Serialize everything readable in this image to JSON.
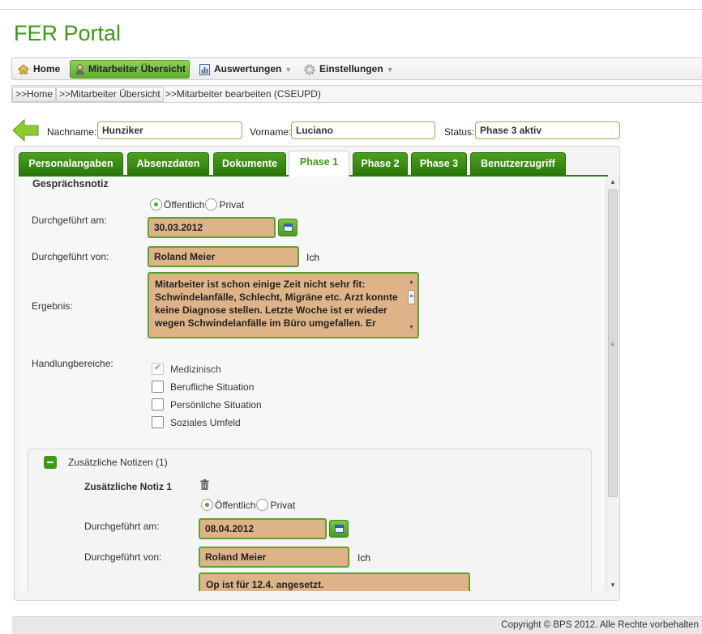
{
  "app": {
    "title": "FER Portal"
  },
  "nav": {
    "home": "Home",
    "mitarbeiter": "Mitarbeiter Übersicht",
    "auswertungen": "Auswertungen",
    "einstellungen": "Einstellungen"
  },
  "breadcrumb": {
    "home": ">>Home",
    "mitarbeiter": ">>Mitarbeiter Übersicht",
    "current": ">>Mitarbeiter bearbeiten (CSEUPD)"
  },
  "header": {
    "nachname_label": "Nachname:",
    "nachname_value": "Hunziker",
    "vorname_label": "Vorname:",
    "vorname_value": "Luciano",
    "status_label": "Status:",
    "status_value": "Phase 3 aktiv"
  },
  "tabs": [
    {
      "label": "Personalangaben"
    },
    {
      "label": "Absenzdaten"
    },
    {
      "label": "Dokumente"
    },
    {
      "label": "Phase 1",
      "active": true
    },
    {
      "label": "Phase 2"
    },
    {
      "label": "Phase 3"
    },
    {
      "label": "Benutzerzugriff"
    }
  ],
  "form": {
    "section_title": "Gesprächsnotiz",
    "visibility": {
      "public": "Öffentlich",
      "private": "Privat",
      "selected": "Öffentlich"
    },
    "date_label": "Durchgeführt am:",
    "date_value": "30.03.2012",
    "by_label": "Durchgeführt von:",
    "by_value": "Roland Meier",
    "by_me": "Ich",
    "result_label": "Ergebnis:",
    "result_value": "Mitarbeiter ist schon einige Zeit nicht sehr fit: Schwindelanfälle, Schlecht, Migräne etc. Arzt konnte keine Diagnose stellen. Letzte Woche ist er wieder wegen Schwindelanfälle im Büro umgefallen.  Er",
    "areas_label": "Handlungbereiche:",
    "areas": [
      {
        "label": "Medizinisch",
        "checked": true
      },
      {
        "label": "Berufliche Situation",
        "checked": false
      },
      {
        "label": "Persönliche Situation",
        "checked": false
      },
      {
        "label": "Soziales Umfeld",
        "checked": false
      }
    ]
  },
  "notes": {
    "header": "Zusätzliche Notizen (1)",
    "note_title": "Zusätzliche Notiz 1",
    "visibility": {
      "public": "Öffentlich",
      "private": "Privat",
      "selected": "Öffentlich"
    },
    "date_label": "Durchgeführt am:",
    "date_value": "08.04.2012",
    "by_label": "Durchgeführt von:",
    "by_value": "Roland Meier",
    "by_me": "Ich",
    "text_value": "Op ist für 12.4. angesetzt."
  },
  "footer": {
    "copyright": "Copyright © BPS 2012. Alle Rechte vorbehalten"
  },
  "colors": {
    "brand_green": "#3c9a17",
    "field_tan": "#dfb388",
    "tab_green": "#2d7a0c"
  },
  "icons": [
    "home-icon",
    "user-icon",
    "chart-icon",
    "gear-icon",
    "back-arrow-icon",
    "calendar-icon",
    "trash-icon",
    "collapse-icon"
  ]
}
